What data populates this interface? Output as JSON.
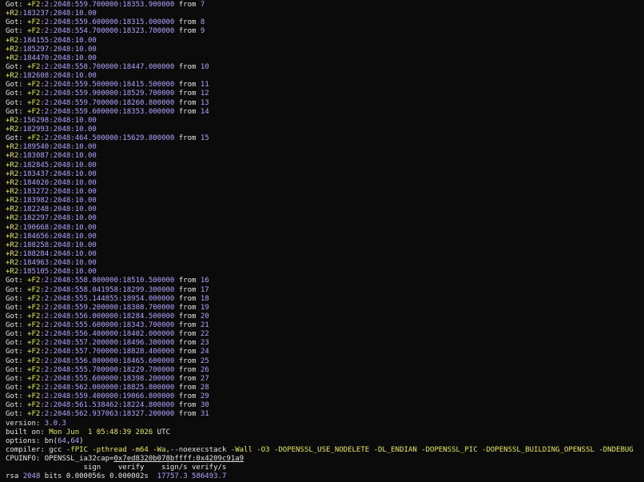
{
  "colors": {
    "background": "#0b0b0b",
    "text": "#e6e6e6",
    "yellow": "#e8e85a",
    "purple": "#b8a2ff",
    "green": "#9fe08a"
  },
  "lines": [
    [
      {
        "t": "Got: ",
        "c": "w"
      },
      {
        "t": "+F2",
        "c": "y"
      },
      {
        "t": ":2:2048:559.700000:18353.900000",
        "c": "p"
      },
      {
        "t": " from ",
        "c": "w"
      },
      {
        "t": "7",
        "c": "p"
      }
    ],
    [
      {
        "t": "+R2",
        "c": "y"
      },
      {
        "t": ":183237:2048:10.00",
        "c": "p"
      }
    ],
    [
      {
        "t": "Got: ",
        "c": "w"
      },
      {
        "t": "+F2",
        "c": "y"
      },
      {
        "t": ":2:2048:559.600000:18315.000000",
        "c": "p"
      },
      {
        "t": " from ",
        "c": "w"
      },
      {
        "t": "8",
        "c": "p"
      }
    ],
    [
      {
        "t": "Got: ",
        "c": "w"
      },
      {
        "t": "+F2",
        "c": "y"
      },
      {
        "t": ":2:2048:554.700000:18323.700000",
        "c": "p"
      },
      {
        "t": " from ",
        "c": "w"
      },
      {
        "t": "9",
        "c": "p"
      }
    ],
    [
      {
        "t": "+R2",
        "c": "y"
      },
      {
        "t": ":184155:2048:10.00",
        "c": "p"
      }
    ],
    [
      {
        "t": "+R2",
        "c": "y"
      },
      {
        "t": ":185297:2048:10.00",
        "c": "p"
      }
    ],
    [
      {
        "t": "+R2",
        "c": "y"
      },
      {
        "t": ":184470:2048:10.00",
        "c": "p"
      }
    ],
    [
      {
        "t": "Got: ",
        "c": "w"
      },
      {
        "t": "+F2",
        "c": "y"
      },
      {
        "t": ":2:2048:558.700000:18447.000000",
        "c": "p"
      },
      {
        "t": " from ",
        "c": "w"
      },
      {
        "t": "10",
        "c": "p"
      }
    ],
    [
      {
        "t": "+R2",
        "c": "y"
      },
      {
        "t": ":182608:2048:10.00",
        "c": "p"
      }
    ],
    [
      {
        "t": "Got: ",
        "c": "w"
      },
      {
        "t": "+F2",
        "c": "y"
      },
      {
        "t": ":2:2048:559.500000:18415.500000",
        "c": "p"
      },
      {
        "t": " from ",
        "c": "w"
      },
      {
        "t": "11",
        "c": "p"
      }
    ],
    [
      {
        "t": "Got: ",
        "c": "w"
      },
      {
        "t": "+F2",
        "c": "y"
      },
      {
        "t": ":2:2048:559.900000:18529.700000",
        "c": "p"
      },
      {
        "t": " from ",
        "c": "w"
      },
      {
        "t": "12",
        "c": "p"
      }
    ],
    [
      {
        "t": "Got: ",
        "c": "w"
      },
      {
        "t": "+F2",
        "c": "y"
      },
      {
        "t": ":2:2048:559.700000:18260.800000",
        "c": "p"
      },
      {
        "t": " from ",
        "c": "w"
      },
      {
        "t": "13",
        "c": "p"
      }
    ],
    [
      {
        "t": "Got: ",
        "c": "w"
      },
      {
        "t": "+F2",
        "c": "y"
      },
      {
        "t": ":2:2048:559.600000:18353.000000",
        "c": "p"
      },
      {
        "t": " from ",
        "c": "w"
      },
      {
        "t": "14",
        "c": "p"
      }
    ],
    [
      {
        "t": "+R2",
        "c": "y"
      },
      {
        "t": ":156298:2048:10.00",
        "c": "p"
      }
    ],
    [
      {
        "t": "+R2",
        "c": "y"
      },
      {
        "t": ":182993:2048:10.00",
        "c": "p"
      }
    ],
    [
      {
        "t": "Got: ",
        "c": "w"
      },
      {
        "t": "+F2",
        "c": "y"
      },
      {
        "t": ":2:2048:464.500000:15629.800000",
        "c": "p"
      },
      {
        "t": " from ",
        "c": "w"
      },
      {
        "t": "15",
        "c": "p"
      }
    ],
    [
      {
        "t": "+R2",
        "c": "y"
      },
      {
        "t": ":189540:2048:10.00",
        "c": "p"
      }
    ],
    [
      {
        "t": "+R2",
        "c": "y"
      },
      {
        "t": ":183087:2048:10.00",
        "c": "p"
      }
    ],
    [
      {
        "t": "+R2",
        "c": "y"
      },
      {
        "t": ":182845:2048:10.00",
        "c": "p"
      }
    ],
    [
      {
        "t": "+R2",
        "c": "y"
      },
      {
        "t": ":183437:2048:10.00",
        "c": "p"
      }
    ],
    [
      {
        "t": "+R2",
        "c": "y"
      },
      {
        "t": ":184020:2048:10.00",
        "c": "p"
      }
    ],
    [
      {
        "t": "+R2",
        "c": "y"
      },
      {
        "t": ":183272:2048:10.00",
        "c": "p"
      }
    ],
    [
      {
        "t": "+R2",
        "c": "y"
      },
      {
        "t": ":183982:2048:10.00",
        "c": "p"
      }
    ],
    [
      {
        "t": "+R2",
        "c": "y"
      },
      {
        "t": ":182248:2048:10.00",
        "c": "p"
      }
    ],
    [
      {
        "t": "+R2",
        "c": "y"
      },
      {
        "t": ":182297:2048:10.00",
        "c": "p"
      }
    ],
    [
      {
        "t": "+R2",
        "c": "y"
      },
      {
        "t": ":190668:2048:10.00",
        "c": "p"
      }
    ],
    [
      {
        "t": "+R2",
        "c": "y"
      },
      {
        "t": ":184656:2048:10.00",
        "c": "p"
      }
    ],
    [
      {
        "t": "+R2",
        "c": "y"
      },
      {
        "t": ":188258:2048:10.00",
        "c": "p"
      }
    ],
    [
      {
        "t": "+R2",
        "c": "y"
      },
      {
        "t": ":188284:2048:10.00",
        "c": "p"
      }
    ],
    [
      {
        "t": "+R2",
        "c": "y"
      },
      {
        "t": ":184963:2048:10.00",
        "c": "p"
      }
    ],
    [
      {
        "t": "+R2",
        "c": "y"
      },
      {
        "t": ":185105:2048:10.00",
        "c": "p"
      }
    ],
    [
      {
        "t": "Got: ",
        "c": "w"
      },
      {
        "t": "+F2",
        "c": "y"
      },
      {
        "t": ":2:2048:558.800000:18510.500000",
        "c": "p"
      },
      {
        "t": " from ",
        "c": "w"
      },
      {
        "t": "16",
        "c": "p"
      }
    ],
    [
      {
        "t": "Got: ",
        "c": "w"
      },
      {
        "t": "+F2",
        "c": "y"
      },
      {
        "t": ":2:2048:558.041958:18299.300000",
        "c": "p"
      },
      {
        "t": " from ",
        "c": "w"
      },
      {
        "t": "17",
        "c": "p"
      }
    ],
    [
      {
        "t": "Got: ",
        "c": "w"
      },
      {
        "t": "+F2",
        "c": "y"
      },
      {
        "t": ":2:2048:555.144855:18954.000000",
        "c": "p"
      },
      {
        "t": " from ",
        "c": "w"
      },
      {
        "t": "18",
        "c": "p"
      }
    ],
    [
      {
        "t": "Got: ",
        "c": "w"
      },
      {
        "t": "+F2",
        "c": "y"
      },
      {
        "t": ":2:2048:559.200000:18308.700000",
        "c": "p"
      },
      {
        "t": " from ",
        "c": "w"
      },
      {
        "t": "19",
        "c": "p"
      }
    ],
    [
      {
        "t": "Got: ",
        "c": "w"
      },
      {
        "t": "+F2",
        "c": "y"
      },
      {
        "t": ":2:2048:556.000000:18284.500000",
        "c": "p"
      },
      {
        "t": " from ",
        "c": "w"
      },
      {
        "t": "20",
        "c": "p"
      }
    ],
    [
      {
        "t": "Got: ",
        "c": "w"
      },
      {
        "t": "+F2",
        "c": "y"
      },
      {
        "t": ":2:2048:555.600000:18343.700000",
        "c": "p"
      },
      {
        "t": " from ",
        "c": "w"
      },
      {
        "t": "21",
        "c": "p"
      }
    ],
    [
      {
        "t": "Got: ",
        "c": "w"
      },
      {
        "t": "+F2",
        "c": "y"
      },
      {
        "t": ":2:2048:556.400000:18402.000000",
        "c": "p"
      },
      {
        "t": " from ",
        "c": "w"
      },
      {
        "t": "22",
        "c": "p"
      }
    ],
    [
      {
        "t": "Got: ",
        "c": "w"
      },
      {
        "t": "+F2",
        "c": "y"
      },
      {
        "t": ":2:2048:557.200000:18496.300000",
        "c": "p"
      },
      {
        "t": " from ",
        "c": "w"
      },
      {
        "t": "23",
        "c": "p"
      }
    ],
    [
      {
        "t": "Got: ",
        "c": "w"
      },
      {
        "t": "+F2",
        "c": "y"
      },
      {
        "t": ":2:2048:557.700000:18828.400000",
        "c": "p"
      },
      {
        "t": " from ",
        "c": "w"
      },
      {
        "t": "24",
        "c": "p"
      }
    ],
    [
      {
        "t": "Got: ",
        "c": "w"
      },
      {
        "t": "+F2",
        "c": "y"
      },
      {
        "t": ":2:2048:556.800000:18465.600000",
        "c": "p"
      },
      {
        "t": " from ",
        "c": "w"
      },
      {
        "t": "25",
        "c": "p"
      }
    ],
    [
      {
        "t": "Got: ",
        "c": "w"
      },
      {
        "t": "+F2",
        "c": "y"
      },
      {
        "t": ":2:2048:555.700000:18229.700000",
        "c": "p"
      },
      {
        "t": " from ",
        "c": "w"
      },
      {
        "t": "26",
        "c": "p"
      }
    ],
    [
      {
        "t": "Got: ",
        "c": "w"
      },
      {
        "t": "+F2",
        "c": "y"
      },
      {
        "t": ":2:2048:555.600000:18398.200000",
        "c": "p"
      },
      {
        "t": " from ",
        "c": "w"
      },
      {
        "t": "27",
        "c": "p"
      }
    ],
    [
      {
        "t": "Got: ",
        "c": "w"
      },
      {
        "t": "+F2",
        "c": "y"
      },
      {
        "t": ":2:2048:562.000000:18825.800000",
        "c": "p"
      },
      {
        "t": " from ",
        "c": "w"
      },
      {
        "t": "28",
        "c": "p"
      }
    ],
    [
      {
        "t": "Got: ",
        "c": "w"
      },
      {
        "t": "+F2",
        "c": "y"
      },
      {
        "t": ":2:2048:559.400000:19066.800000",
        "c": "p"
      },
      {
        "t": " from ",
        "c": "w"
      },
      {
        "t": "29",
        "c": "p"
      }
    ],
    [
      {
        "t": "Got: ",
        "c": "w"
      },
      {
        "t": "+F2",
        "c": "y"
      },
      {
        "t": ":2:2048:561.538462:18224.800000",
        "c": "p"
      },
      {
        "t": " from ",
        "c": "w"
      },
      {
        "t": "30",
        "c": "p"
      }
    ],
    [
      {
        "t": "Got: ",
        "c": "w"
      },
      {
        "t": "+F2",
        "c": "y"
      },
      {
        "t": ":2:2048:562.937063:18327.200000",
        "c": "p"
      },
      {
        "t": " from ",
        "c": "w"
      },
      {
        "t": "31",
        "c": "p"
      }
    ],
    [
      {
        "t": "version: ",
        "c": "w"
      },
      {
        "t": "3.0.3",
        "c": "p"
      }
    ],
    [
      {
        "t": "built on: ",
        "c": "w"
      },
      {
        "t": "Mon Jun  1 05:48:39 2026",
        "c": "y"
      },
      {
        "t": " UTC",
        "c": "w"
      }
    ],
    [
      {
        "t": "options: ",
        "c": "w"
      },
      {
        "t": "bn(",
        "c": "w"
      },
      {
        "t": "64",
        "c": "p"
      },
      {
        "t": ",",
        "c": "w"
      },
      {
        "t": "64",
        "c": "p"
      },
      {
        "t": ")",
        "c": "w"
      }
    ],
    [
      {
        "t": "compiler: ",
        "c": "w"
      },
      {
        "t": "gcc ",
        "c": "w"
      },
      {
        "t": "-fPIC -pthread -m64 -Wa,",
        "c": "y"
      },
      {
        "t": "--noexecstack ",
        "c": "w"
      },
      {
        "t": "-Wall -O3 -DOPENSSL_USE_NODELETE -DL_ENDIAN -DOPENSSL_PIC -DOPENSSL_BUILDING_OPENSSL -DNDEBUG",
        "c": "y"
      }
    ],
    [
      {
        "t": "CPUINFO: OPENSSL_ia32cap=",
        "c": "w"
      },
      {
        "t": "0x7ed8320b078bffff:0x4209c91a9",
        "c": "w",
        "u": true
      }
    ],
    [
      {
        "t": "                  sign    verify    sign/s verify/s",
        "c": "w"
      }
    ],
    [
      {
        "t": "rsa ",
        "c": "w"
      },
      {
        "t": "2048",
        "c": "p"
      },
      {
        "t": " bits 0.000056s 0.000002s  ",
        "c": "w"
      },
      {
        "t": "17757.3",
        "c": "p"
      },
      {
        "t": " ",
        "c": "w"
      },
      {
        "t": "586493.7",
        "c": "p"
      }
    ]
  ]
}
